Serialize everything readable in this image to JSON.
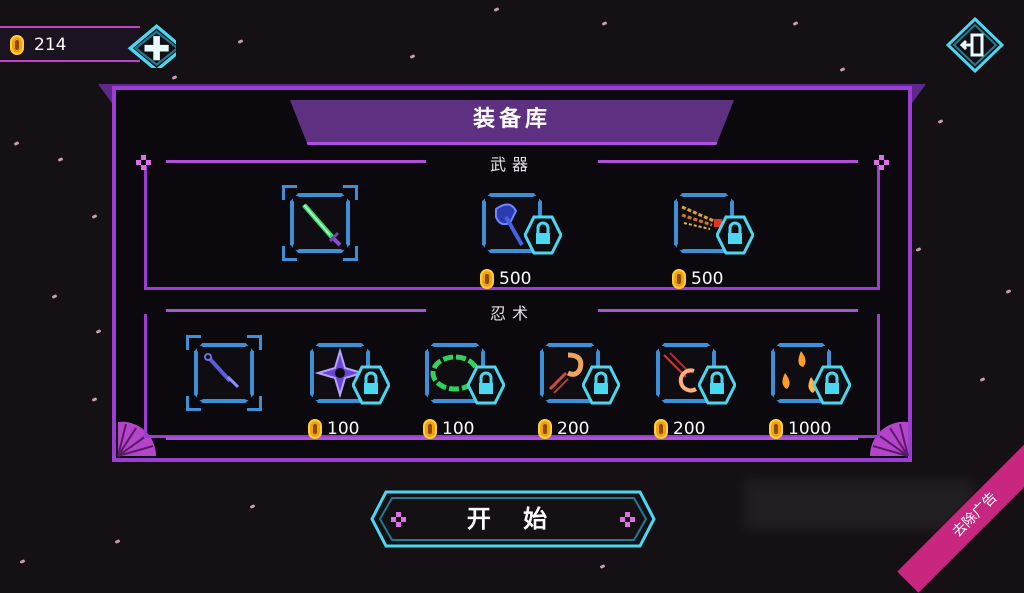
{
  "hud": {
    "coins": "214",
    "add_button_icon": "plus-icon",
    "exit_button_icon": "exit-door-icon"
  },
  "panel": {
    "title": "装备库",
    "sections": [
      {
        "label": "武器"
      },
      {
        "label": "忍术"
      }
    ]
  },
  "weapons": [
    {
      "name": "green-katana",
      "price": "",
      "locked": false,
      "selected": true
    },
    {
      "name": "blue-axe",
      "price": "500",
      "locked": true,
      "selected": false
    },
    {
      "name": "flaming-spear",
      "price": "500",
      "locked": true,
      "selected": false
    }
  ],
  "ninjutsu": [
    {
      "name": "kunai",
      "price": "",
      "locked": false,
      "selected": true
    },
    {
      "name": "shuriken",
      "price": "100",
      "locked": true,
      "selected": false
    },
    {
      "name": "green-ring",
      "price": "100",
      "locked": true,
      "selected": false
    },
    {
      "name": "fire-swirl",
      "price": "200",
      "locked": true,
      "selected": false
    },
    {
      "name": "crescent-slash",
      "price": "200",
      "locked": true,
      "selected": false
    },
    {
      "name": "fire-flames",
      "price": "1000",
      "locked": true,
      "selected": false
    }
  ],
  "start_button": {
    "label": "开 始"
  },
  "ad_ribbon": {
    "label": "去除广告"
  },
  "colors": {
    "frame": "#9b3dd2",
    "accent": "#4ad7ef",
    "coin": "#f2a20c",
    "ribbon": "#c8277f"
  }
}
